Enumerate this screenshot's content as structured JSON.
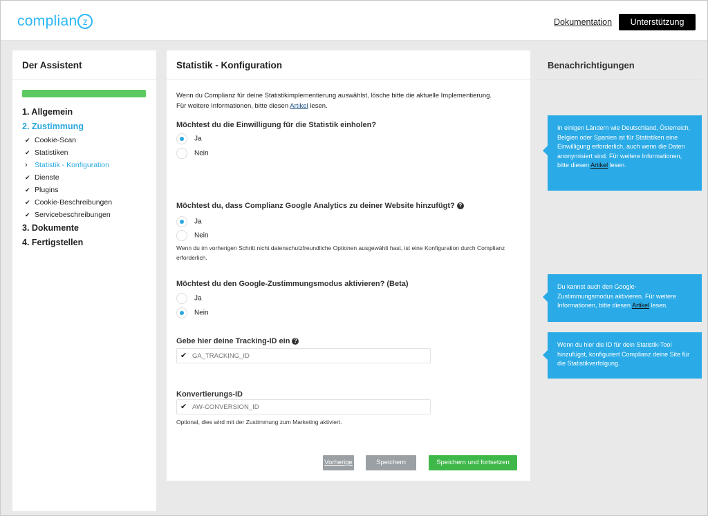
{
  "header": {
    "logo_text": "complian",
    "logo_z": "z",
    "doc_link": "Dokumentation",
    "support_button": "Unterstützung"
  },
  "sidebar": {
    "title": "Der Assistent",
    "progress_pct": 100,
    "steps": [
      {
        "label": "1. Allgemein"
      },
      {
        "label": "2. Zustimmung"
      },
      {
        "label": "3. Dokumente"
      },
      {
        "label": "4. Fertigstellen"
      }
    ],
    "substeps": [
      {
        "label": "Cookie-Scan",
        "icon": "check-icon"
      },
      {
        "label": "Statistiken",
        "icon": "check-icon"
      },
      {
        "label": "Statistik - Konfiguration",
        "icon": "chevron-right-icon"
      },
      {
        "label": "Dienste",
        "icon": "check-icon"
      },
      {
        "label": "Plugins",
        "icon": "check-icon"
      },
      {
        "label": "Cookie-Beschreibungen",
        "icon": "check-icon"
      },
      {
        "label": "Servicebeschreibungen",
        "icon": "check-icon"
      }
    ]
  },
  "main": {
    "title": "Statistik - Konfiguration",
    "intro_text": "Wenn du Complianz für deine Statistikimplementierung auswählst, lösche bitte die aktuelle Implementierung. Für weitere Informationen, bitte diesen",
    "intro_link": "Artikel",
    "intro_end": "lesen.",
    "q1": {
      "label": "Möchtest du die Einwilligung für die Statistik einholen?",
      "opt_yes": "Ja",
      "opt_no": "Nein",
      "selected": "Ja"
    },
    "q2": {
      "label": "Möchtest du, dass Complianz Google Analytics zu deiner Website hinzufügt?",
      "opt_yes": "Ja",
      "opt_no": "Nein",
      "selected": "Ja",
      "note": "Wenn du im vorherigen Schritt nicht datenschutzfreundliche Optionen ausgewählt hast, ist eine Konfiguration durch Complianz erforderlich."
    },
    "q3": {
      "label": "Möchtest du den Google-Zustimmungsmodus aktivieren? (Beta)",
      "opt_yes": "Ja",
      "opt_no": "Nein",
      "selected": "Nein"
    },
    "tracking": {
      "label": "Gebe hier deine Tracking-ID ein",
      "placeholder": "GA_TRACKING_ID"
    },
    "conversion": {
      "label": "Konvertierungs-ID",
      "placeholder": "AW-CONVERSION_ID",
      "note": "Optional, dies wird mit der Zustimmung zum Marketing aktiviert."
    },
    "buttons": {
      "prev": "Vorherige",
      "save": "Speichern",
      "next": "Speichern und fortsetzen"
    }
  },
  "notifications": {
    "title": "Benachrichtigungen",
    "n1_text": "In einigen Ländern wie Deutschland, Österreich, Belgien oder Spanien ist für Statistiken eine Einwilligung erforderlich, auch wenn die Daten anonymisiert sind. Für weitere Informationen, bitte diesen",
    "n1_link": "Artikel",
    "n1_end": "lesen.",
    "n2_text": "Du kannst auch den Google-Zustimmungsmodus aktivieren. Für weitere Informationen, bitte diesen",
    "n2_link": "Artikel",
    "n2_end": "lesen.",
    "n3_text": "Wenn du hier die ID für dein Statistik-Tool hinzufügst, konfiguriert Complianz deine Site für die Statistikverfolgung."
  },
  "colors": {
    "accent": "#29a8e0",
    "progress": "#5dc961",
    "save_continue": "#3fb84a",
    "notice": "#2aaae6"
  }
}
